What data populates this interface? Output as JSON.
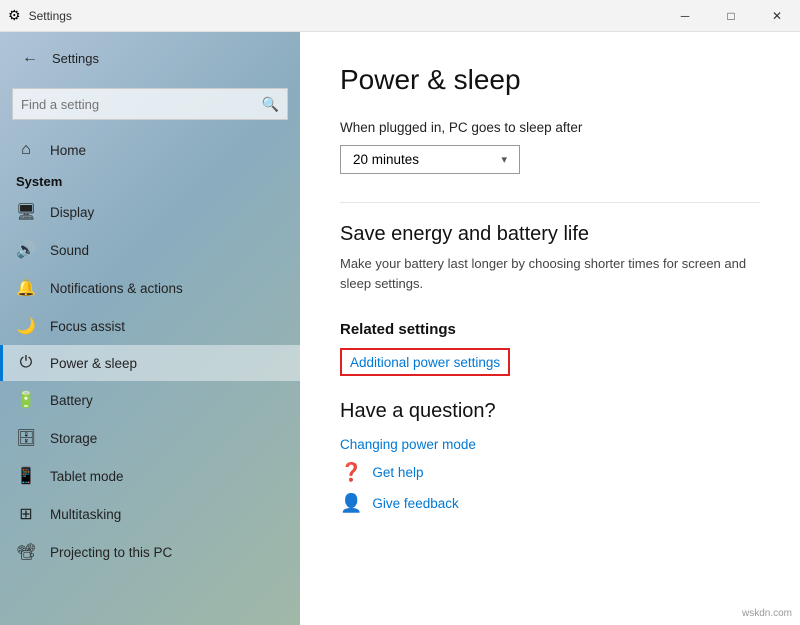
{
  "titlebar": {
    "title": "Settings",
    "minimize": "─",
    "maximize": "□",
    "close": "✕"
  },
  "sidebar": {
    "back_icon": "←",
    "title": "Settings",
    "search_placeholder": "Find a setting",
    "search_icon": "🔍",
    "section_label": "System",
    "items": [
      {
        "id": "display",
        "icon": "🖥",
        "label": "Display"
      },
      {
        "id": "sound",
        "icon": "🔊",
        "label": "Sound"
      },
      {
        "id": "notifications",
        "icon": "🔔",
        "label": "Notifications & actions"
      },
      {
        "id": "focus",
        "icon": "🌙",
        "label": "Focus assist"
      },
      {
        "id": "power",
        "icon": "⏻",
        "label": "Power & sleep",
        "active": true
      },
      {
        "id": "battery",
        "icon": "🔋",
        "label": "Battery"
      },
      {
        "id": "storage",
        "icon": "🗄",
        "label": "Storage"
      },
      {
        "id": "tablet",
        "icon": "📱",
        "label": "Tablet mode"
      },
      {
        "id": "multitasking",
        "icon": "⊞",
        "label": "Multitasking"
      },
      {
        "id": "projecting",
        "icon": "📽",
        "label": "Projecting to this PC"
      }
    ]
  },
  "home_item": {
    "icon": "⌂",
    "label": "Home"
  },
  "content": {
    "page_title": "Power & sleep",
    "sleep_label": "When plugged in, PC goes to sleep after",
    "sleep_dropdown_value": "20 minutes",
    "save_energy_title": "Save energy and battery life",
    "save_energy_desc": "Make your battery last longer by choosing shorter times for screen and sleep settings.",
    "related_settings_title": "Related settings",
    "additional_power_link": "Additional power settings",
    "have_question_title": "Have a question?",
    "changing_power_link": "Changing power mode",
    "get_help_label": "Get help",
    "feedback_label": "Give feedback"
  },
  "watermark": "wskdn.com"
}
